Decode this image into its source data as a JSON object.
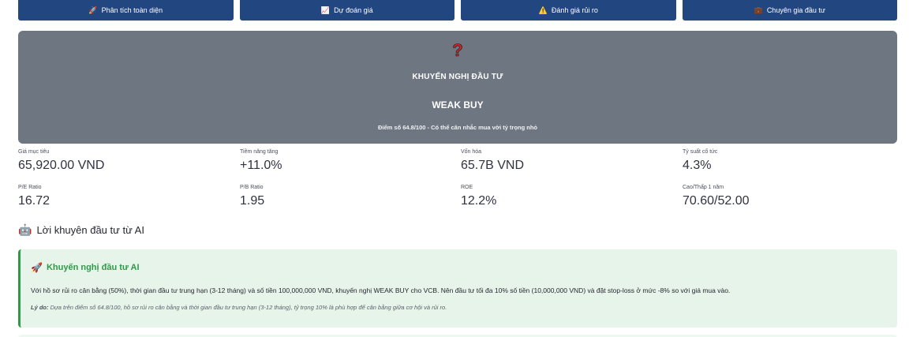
{
  "tabs": [
    {
      "icon": "🚀",
      "label": "Phân tích toàn diện"
    },
    {
      "icon": "📈",
      "label": "Dự đoán giá"
    },
    {
      "icon": "⚠️",
      "label": "Đánh giá rủi ro"
    },
    {
      "icon": "💼",
      "label": "Chuyên gia đầu tư"
    }
  ],
  "recommendation": {
    "icon": "?",
    "label": "KHUYẾN NGHỊ ĐẦU TƯ",
    "value": "WEAK BUY",
    "description": "Điểm số 64.8/100 - Có thể cân nhắc mua với tỷ trọng nhỏ",
    "card_color": "#6d7681"
  },
  "metrics": [
    {
      "label": "Giá mục tiêu",
      "value": "65,920.00 VND"
    },
    {
      "label": "Tiềm năng tăng",
      "value": "+11.0%"
    },
    {
      "label": "Vốn hóa",
      "value": "65.7B VND"
    },
    {
      "label": "Tỷ suất cổ tức",
      "value": "4.3%"
    },
    {
      "label": "P/E Ratio",
      "value": "16.72"
    },
    {
      "label": "P/B Ratio",
      "value": "1.95"
    },
    {
      "label": "ROE",
      "value": "12.2%"
    },
    {
      "label": "Cao/Thấp 1 năm",
      "value": "70.60/52.00"
    }
  ],
  "ai_section": {
    "icon": "🤖",
    "title": "Lời khuyên đầu tư từ AI"
  },
  "advice": {
    "icon": "🚀",
    "title": "Khuyến nghị đầu tư AI",
    "text": "Với hồ sơ rủi ro cân bằng (50%), thời gian đầu tư trung hạn (3-12 tháng) và số tiền 100,000,000 VND, khuyến nghị WEAK BUY cho VCB. Nên đầu tư tối đa 10% số tiền (10,000,000 VND) và đặt stop-loss ở mức -8% so với giá mua vào.",
    "reason_label": "Lý do:",
    "reason": "Dựa trên điểm số 64.8/100, hồ sơ rủi ro cân bằng và thời gian đầu tư trung hạn (3-12 tháng), tỷ trọng 10% là phù hợp để cân bằng giữa cơ hội và rủi ro.",
    "accent_color": "#2e9a49"
  }
}
